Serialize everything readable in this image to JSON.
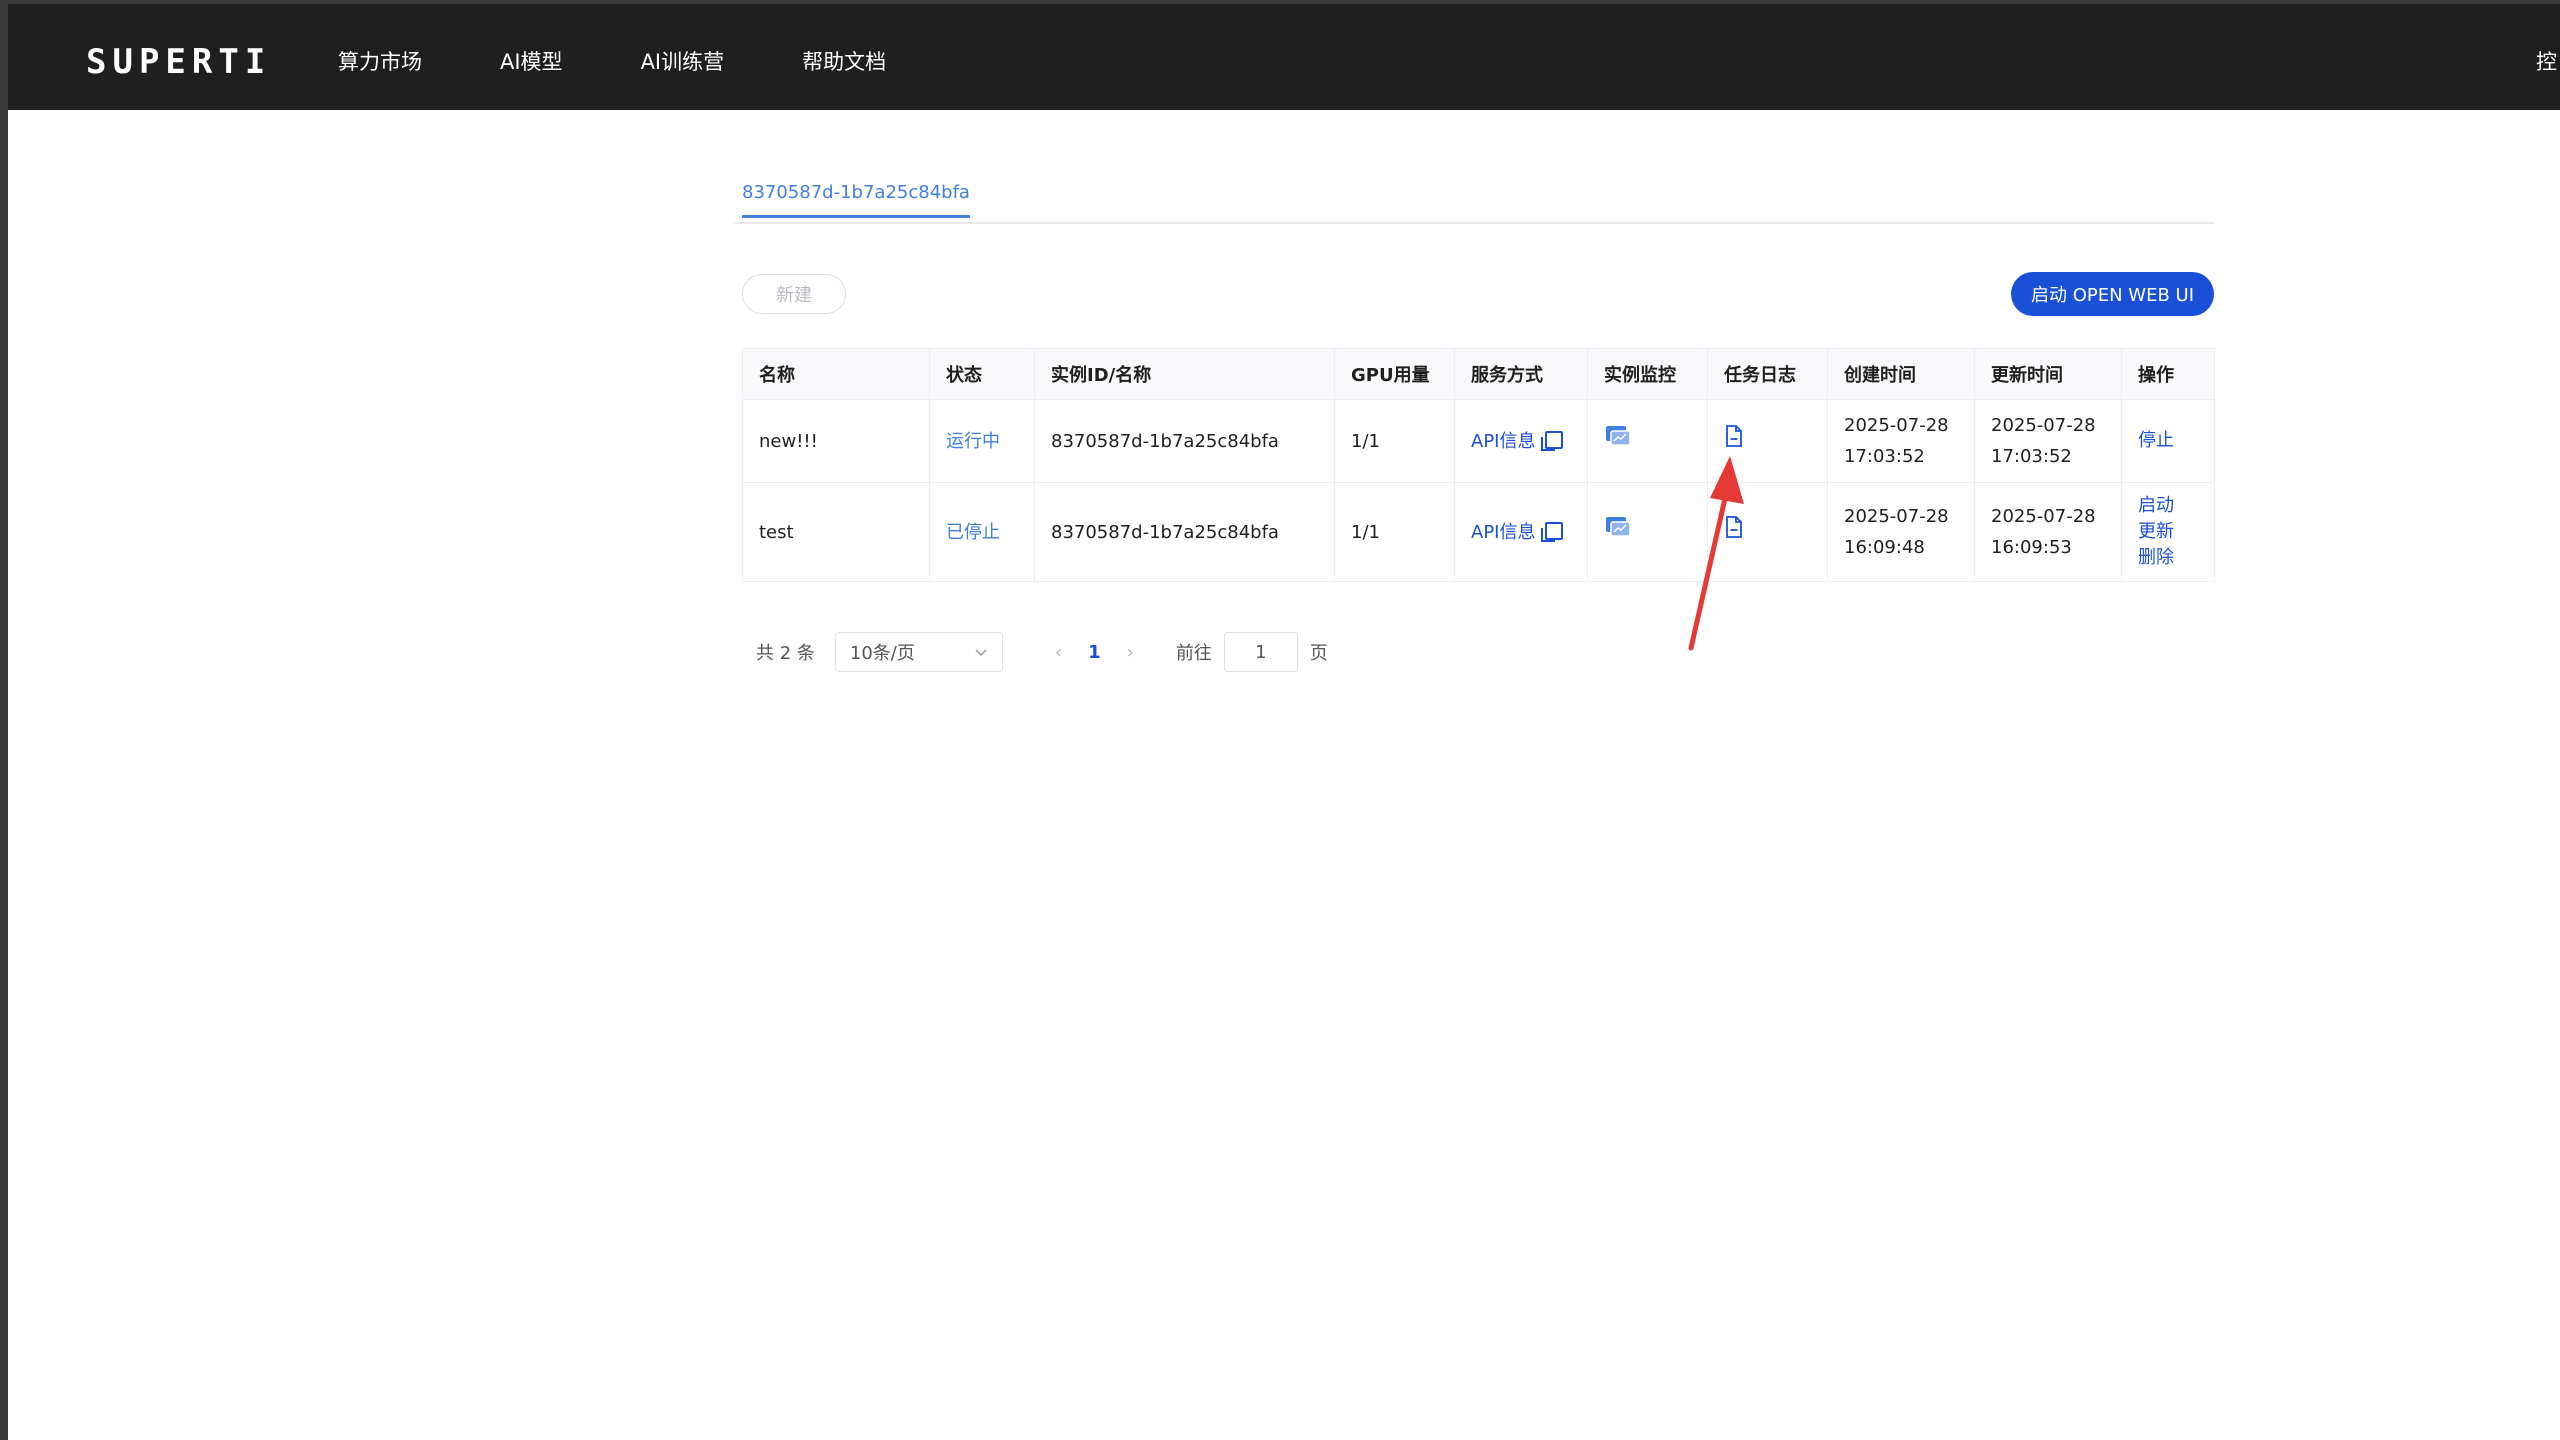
{
  "brand": {
    "logo": "SUPERTI"
  },
  "nav": {
    "items": [
      "算力市场",
      "AI模型",
      "AI训练营",
      "帮助文档"
    ],
    "right_label": "控"
  },
  "tabs": [
    {
      "label": "8370587d-1b7a25c84bfa",
      "active": true
    }
  ],
  "toolbar": {
    "new_label": "新建",
    "open_webui_label": "启动 OPEN WEB UI"
  },
  "table": {
    "headers": [
      "名称",
      "状态",
      "实例ID/名称",
      "GPU用量",
      "服务方式",
      "实例监控",
      "任务日志",
      "创建时间",
      "更新时间",
      "操作"
    ],
    "rows": [
      {
        "name": "new!!!",
        "status": "运行中",
        "instance_id": "8370587d-1b7a25c84bfa",
        "gpu": "1/1",
        "service": "API信息",
        "created_date": "2025-07-28",
        "created_time": "17:03:52",
        "updated_date": "2025-07-28",
        "updated_time": "17:03:52",
        "actions": [
          "停止"
        ]
      },
      {
        "name": "test",
        "status": "已停止",
        "instance_id": "8370587d-1b7a25c84bfa",
        "gpu": "1/1",
        "service": "API信息",
        "created_date": "2025-07-28",
        "created_time": "16:09:48",
        "updated_date": "2025-07-28",
        "updated_time": "16:09:53",
        "actions": [
          "启动",
          "更新",
          "删除"
        ]
      }
    ]
  },
  "pagination": {
    "total": "共 2 条",
    "page_size": "10条/页",
    "current_page": "1",
    "goto_label": "前往",
    "goto_value": "1",
    "page_unit": "页"
  },
  "colors": {
    "accent": "#1a50d8",
    "link": "#3f7fe0",
    "topbar": "#1f1f20",
    "annotation": "#e53935"
  }
}
